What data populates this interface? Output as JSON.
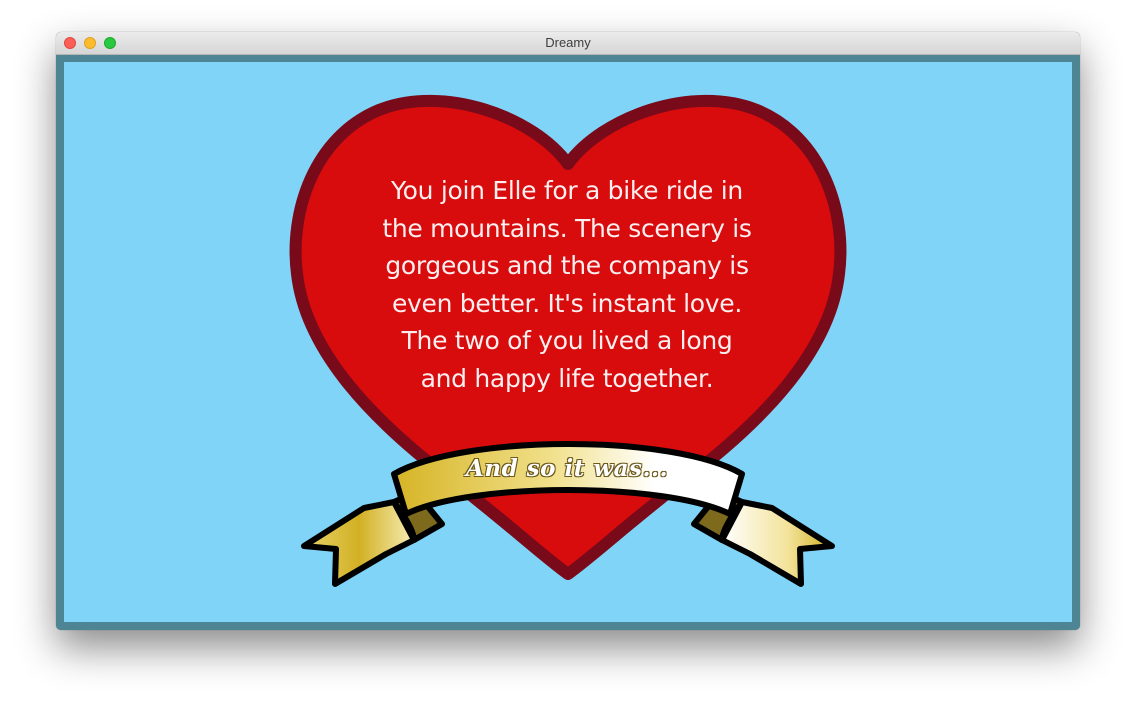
{
  "window": {
    "title": "Dreamy"
  },
  "story": {
    "text": "You join Elle for a bike ride in the mountains. The scenery is gorgeous and the company is even better. It's instant love. The two of you lived a long and happy life together."
  },
  "banner": {
    "text": "And so it was..."
  },
  "colors": {
    "sky": "#80d4f8",
    "frame": "#4e8594",
    "heart": "#d80c0c",
    "heart_outline": "#790a1a",
    "ribbon_gold": "#d9b92a",
    "ribbon_light": "#ffffff"
  }
}
